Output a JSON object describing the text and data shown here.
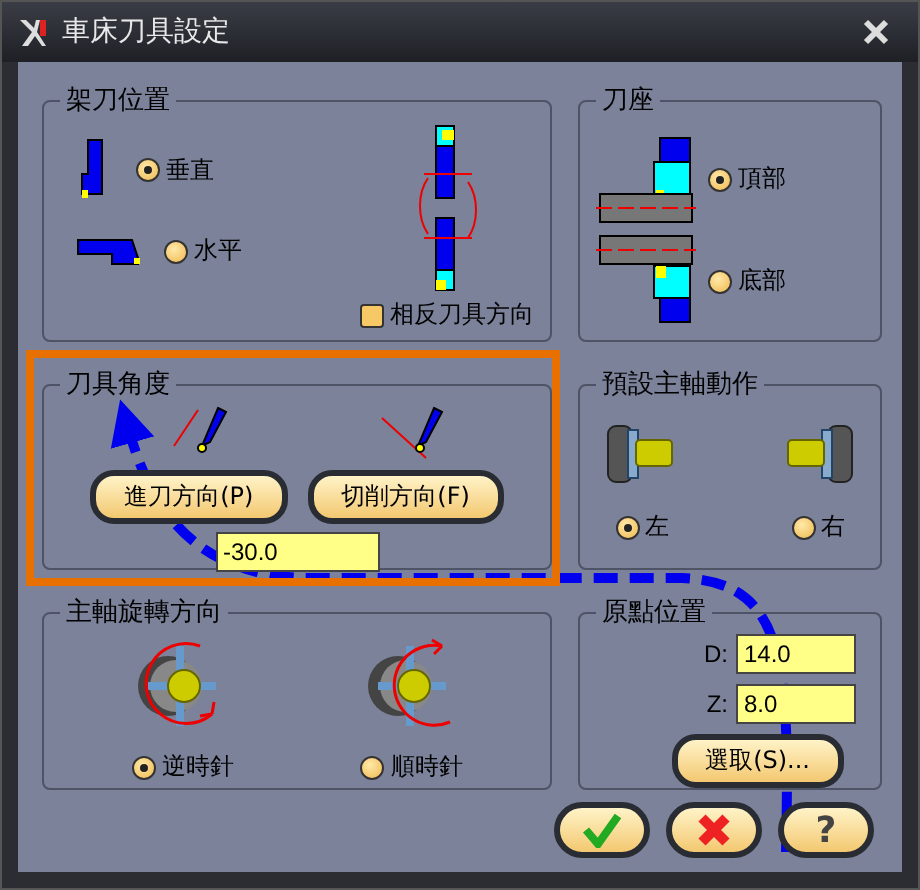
{
  "window": {
    "title": "車床刀具設定"
  },
  "tool_position": {
    "title": "架刀位置",
    "options": [
      {
        "label": "垂直",
        "selected": true
      },
      {
        "label": "水平",
        "selected": false
      }
    ],
    "reverse": {
      "label": "相反刀具方向",
      "checked": false
    }
  },
  "turret": {
    "title": "刀座",
    "options": [
      {
        "label": "頂部",
        "selected": true
      },
      {
        "label": "底部",
        "selected": false
      }
    ]
  },
  "tool_angle": {
    "title": "刀具角度",
    "buttons": [
      "進刀方向(P)",
      "切削方向(F)"
    ],
    "value": "-30.0"
  },
  "default_spindle": {
    "title": "預設主軸動作",
    "options": [
      {
        "label": "左",
        "selected": true
      },
      {
        "label": "右",
        "selected": false
      }
    ]
  },
  "spindle_direction": {
    "title": "主軸旋轉方向",
    "options": [
      {
        "label": "逆時針",
        "selected": true
      },
      {
        "label": "順時針",
        "selected": false
      }
    ]
  },
  "origin": {
    "title": "原點位置",
    "fields": [
      {
        "label": "D:",
        "value": "14.0"
      },
      {
        "label": "Z:",
        "value": "8.0"
      }
    ],
    "button": "選取(S)..."
  },
  "footer_buttons": [
    {
      "kind": "ok"
    },
    {
      "kind": "cancel"
    },
    {
      "kind": "help",
      "label": "?"
    }
  ]
}
